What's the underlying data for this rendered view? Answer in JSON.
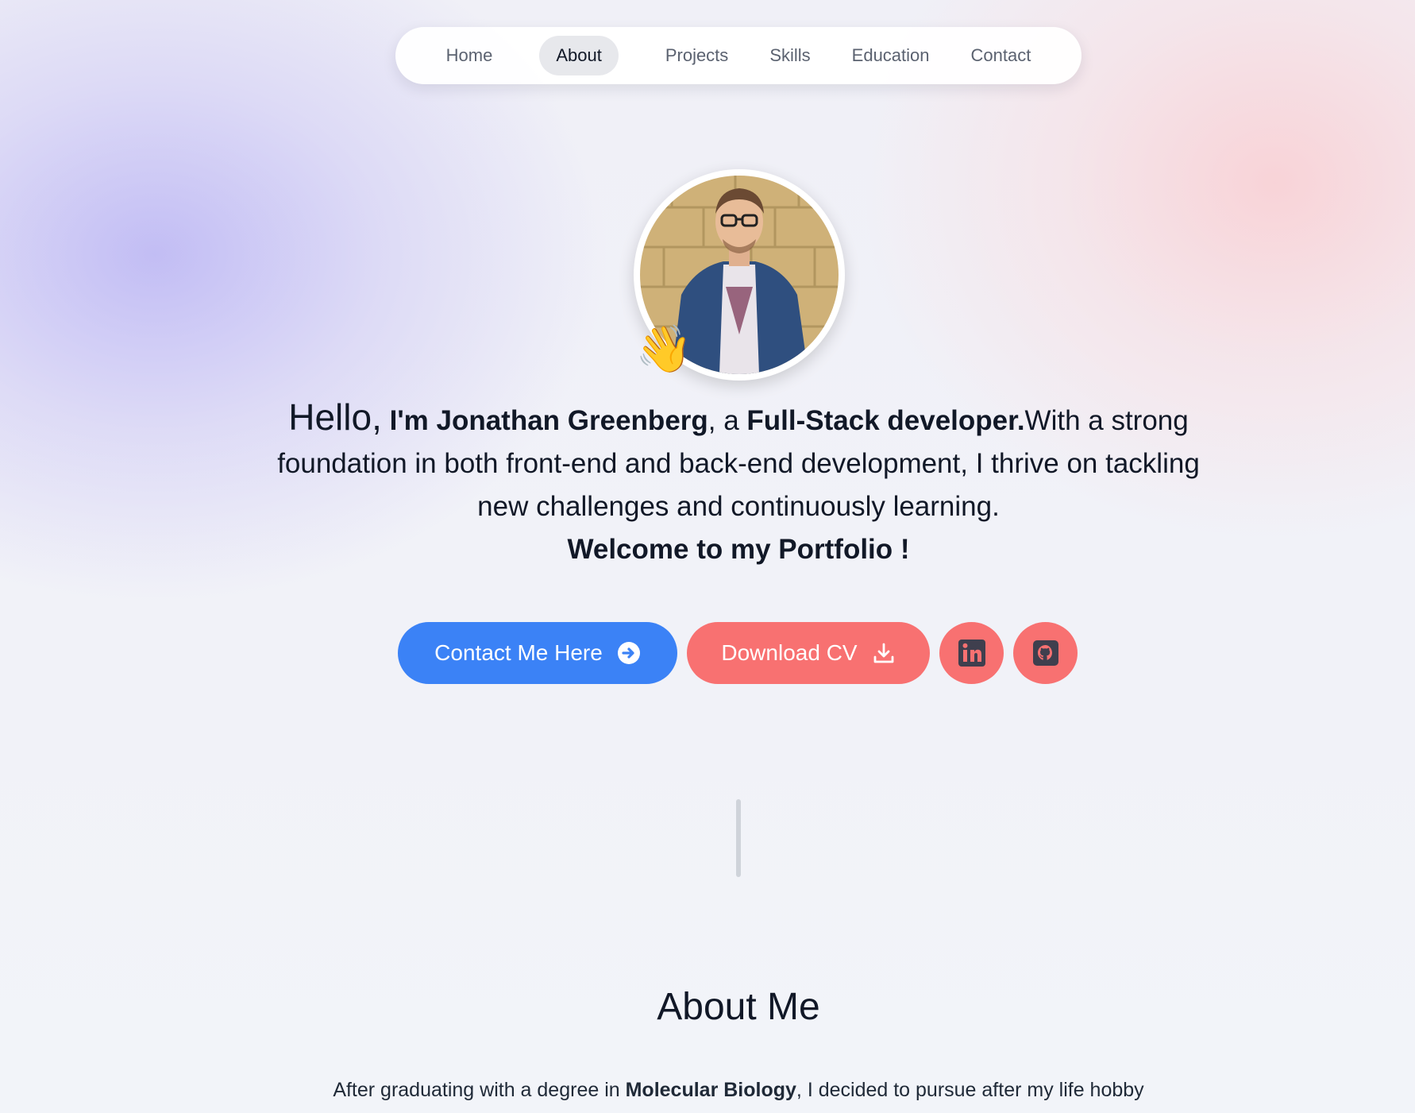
{
  "nav": {
    "items": [
      {
        "label": "Home",
        "active": false
      },
      {
        "label": "About",
        "active": true
      },
      {
        "label": "Projects",
        "active": false
      },
      {
        "label": "Skills",
        "active": false
      },
      {
        "label": "Education",
        "active": false
      },
      {
        "label": "Contact",
        "active": false
      }
    ]
  },
  "hero": {
    "avatar_icon": "profile-photo",
    "wave_emoji": "👋",
    "hello": "Hello,",
    "name": "I'm Jonathan Greenberg",
    "connector": ", a ",
    "role": "Full-Stack developer.",
    "description": "With a strong foundation in both front-end and back-end development, I thrive on tackling new challenges and continuously learning.",
    "welcome": "Welcome to my Portfolio !"
  },
  "actions": {
    "contact_label": "Contact Me Here",
    "download_label": "Download CV",
    "linkedin_icon": "linkedin-icon",
    "github_icon": "github-icon"
  },
  "about": {
    "title": "About Me",
    "text_before": "After graduating with a degree in ",
    "text_bold": "Molecular Biology",
    "text_after": ", I decided to pursue after my life hobby"
  },
  "colors": {
    "primary_button": "#3b82f6",
    "secondary_button": "#f87171",
    "icon_dark": "#3f3f4e"
  }
}
